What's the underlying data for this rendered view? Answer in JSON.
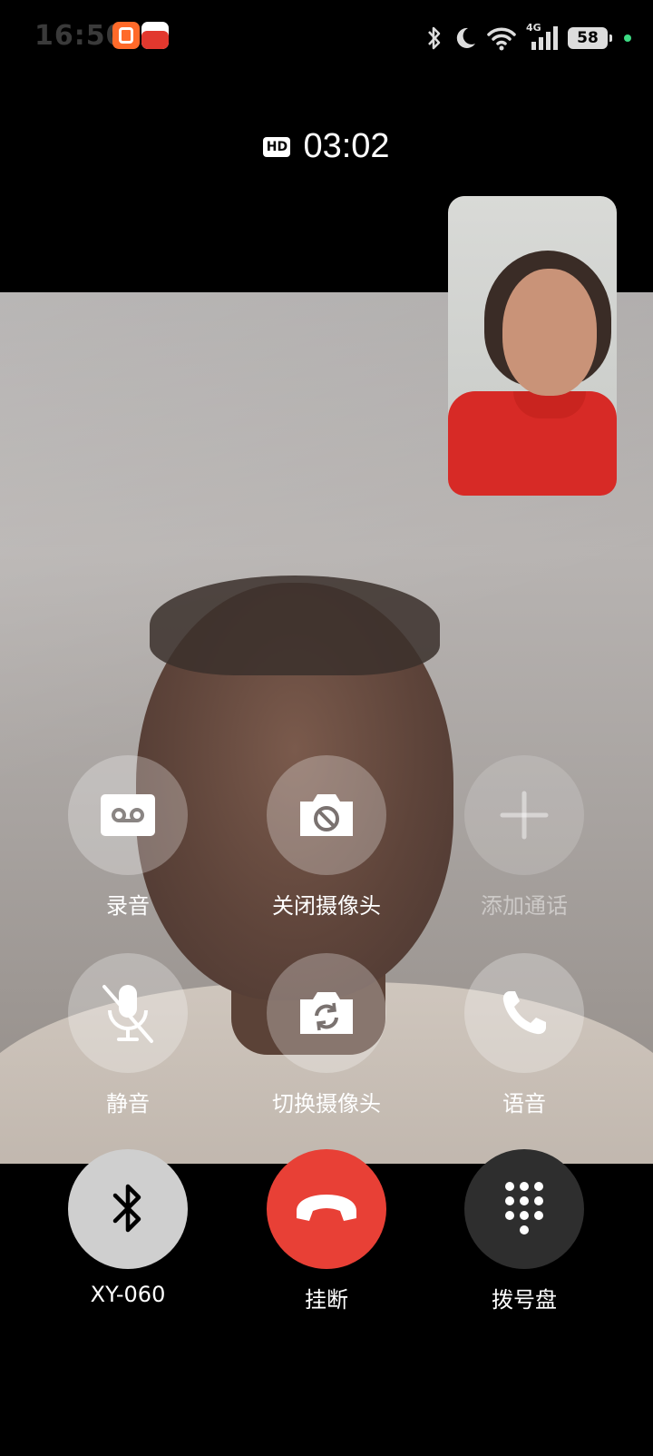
{
  "status_bar": {
    "time": "16:50",
    "battery": "58",
    "network": "4G",
    "icons": [
      "bluetooth-icon",
      "moon-icon",
      "wifi-icon",
      "signal-icon",
      "battery-icon"
    ]
  },
  "call": {
    "hd_badge": "HD",
    "duration": "03:02"
  },
  "controls": {
    "record": {
      "label": "录音",
      "icon": "cassette-icon"
    },
    "camera_off": {
      "label": "关闭摄像头",
      "icon": "camera-off-icon"
    },
    "add_call": {
      "label": "添加通话",
      "icon": "plus-icon",
      "enabled": false
    },
    "mute": {
      "label": "静音",
      "icon": "mic-off-icon"
    },
    "switch_camera": {
      "label": "切换摄像头",
      "icon": "camera-switch-icon"
    },
    "voice": {
      "label": "语音",
      "icon": "phone-icon"
    },
    "bluetooth": {
      "label": "XY-060",
      "icon": "bluetooth-icon"
    },
    "hangup": {
      "label": "挂断",
      "icon": "hangup-icon"
    },
    "dialpad": {
      "label": "拨号盘",
      "icon": "dialpad-icon"
    }
  },
  "colors": {
    "hangup": "#e84036",
    "bluetooth_bg": "#cfcfcf",
    "dialpad_bg": "#2e2e2e"
  }
}
